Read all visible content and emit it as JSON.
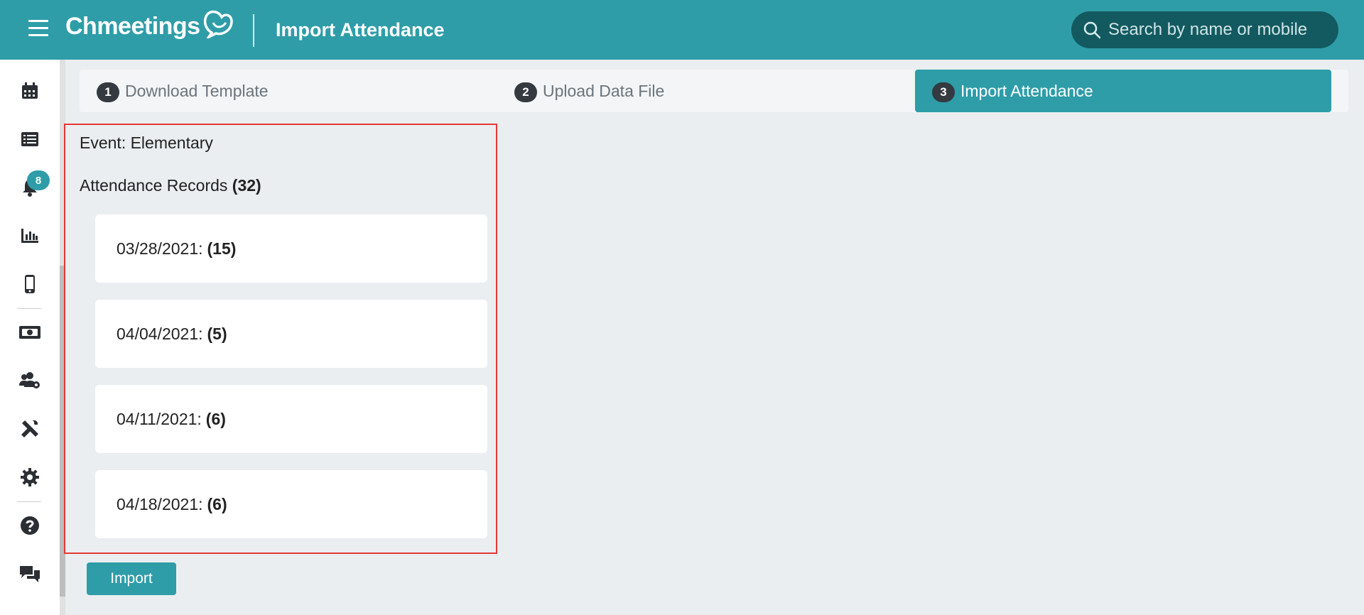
{
  "header": {
    "brand": "Chmeetings",
    "title": "Import Attendance",
    "search_placeholder": "Search by name or mobile"
  },
  "sidebar": {
    "notification_count": "8",
    "items": [
      {
        "icon": "calendar-icon"
      },
      {
        "icon": "list-icon"
      },
      {
        "icon": "bell-icon"
      },
      {
        "icon": "chart-icon"
      },
      {
        "icon": "mobile-icon"
      },
      {
        "icon": "money-icon"
      },
      {
        "icon": "users-cog-icon"
      },
      {
        "icon": "tools-icon"
      },
      {
        "icon": "gear-icon"
      },
      {
        "icon": "help-icon"
      },
      {
        "icon": "chat-icon"
      }
    ]
  },
  "stepper": {
    "steps": [
      {
        "number": "1",
        "label": "Download Template",
        "active": false
      },
      {
        "number": "2",
        "label": "Upload Data File",
        "active": false
      },
      {
        "number": "3",
        "label": "Import Attendance",
        "active": true
      }
    ]
  },
  "summary": {
    "event_text": "Event: Elementary",
    "records_label": "Attendance Records",
    "records_count": "(32)",
    "records": [
      {
        "date": "03/28/2021:",
        "count": "(15)"
      },
      {
        "date": "04/04/2021:",
        "count": "(5)"
      },
      {
        "date": "04/11/2021:",
        "count": "(6)"
      },
      {
        "date": "04/18/2021:",
        "count": "(6)"
      }
    ]
  },
  "actions": {
    "import_label": "Import"
  },
  "colors": {
    "primary": "#2e9da8",
    "highlight": "#e53935"
  }
}
